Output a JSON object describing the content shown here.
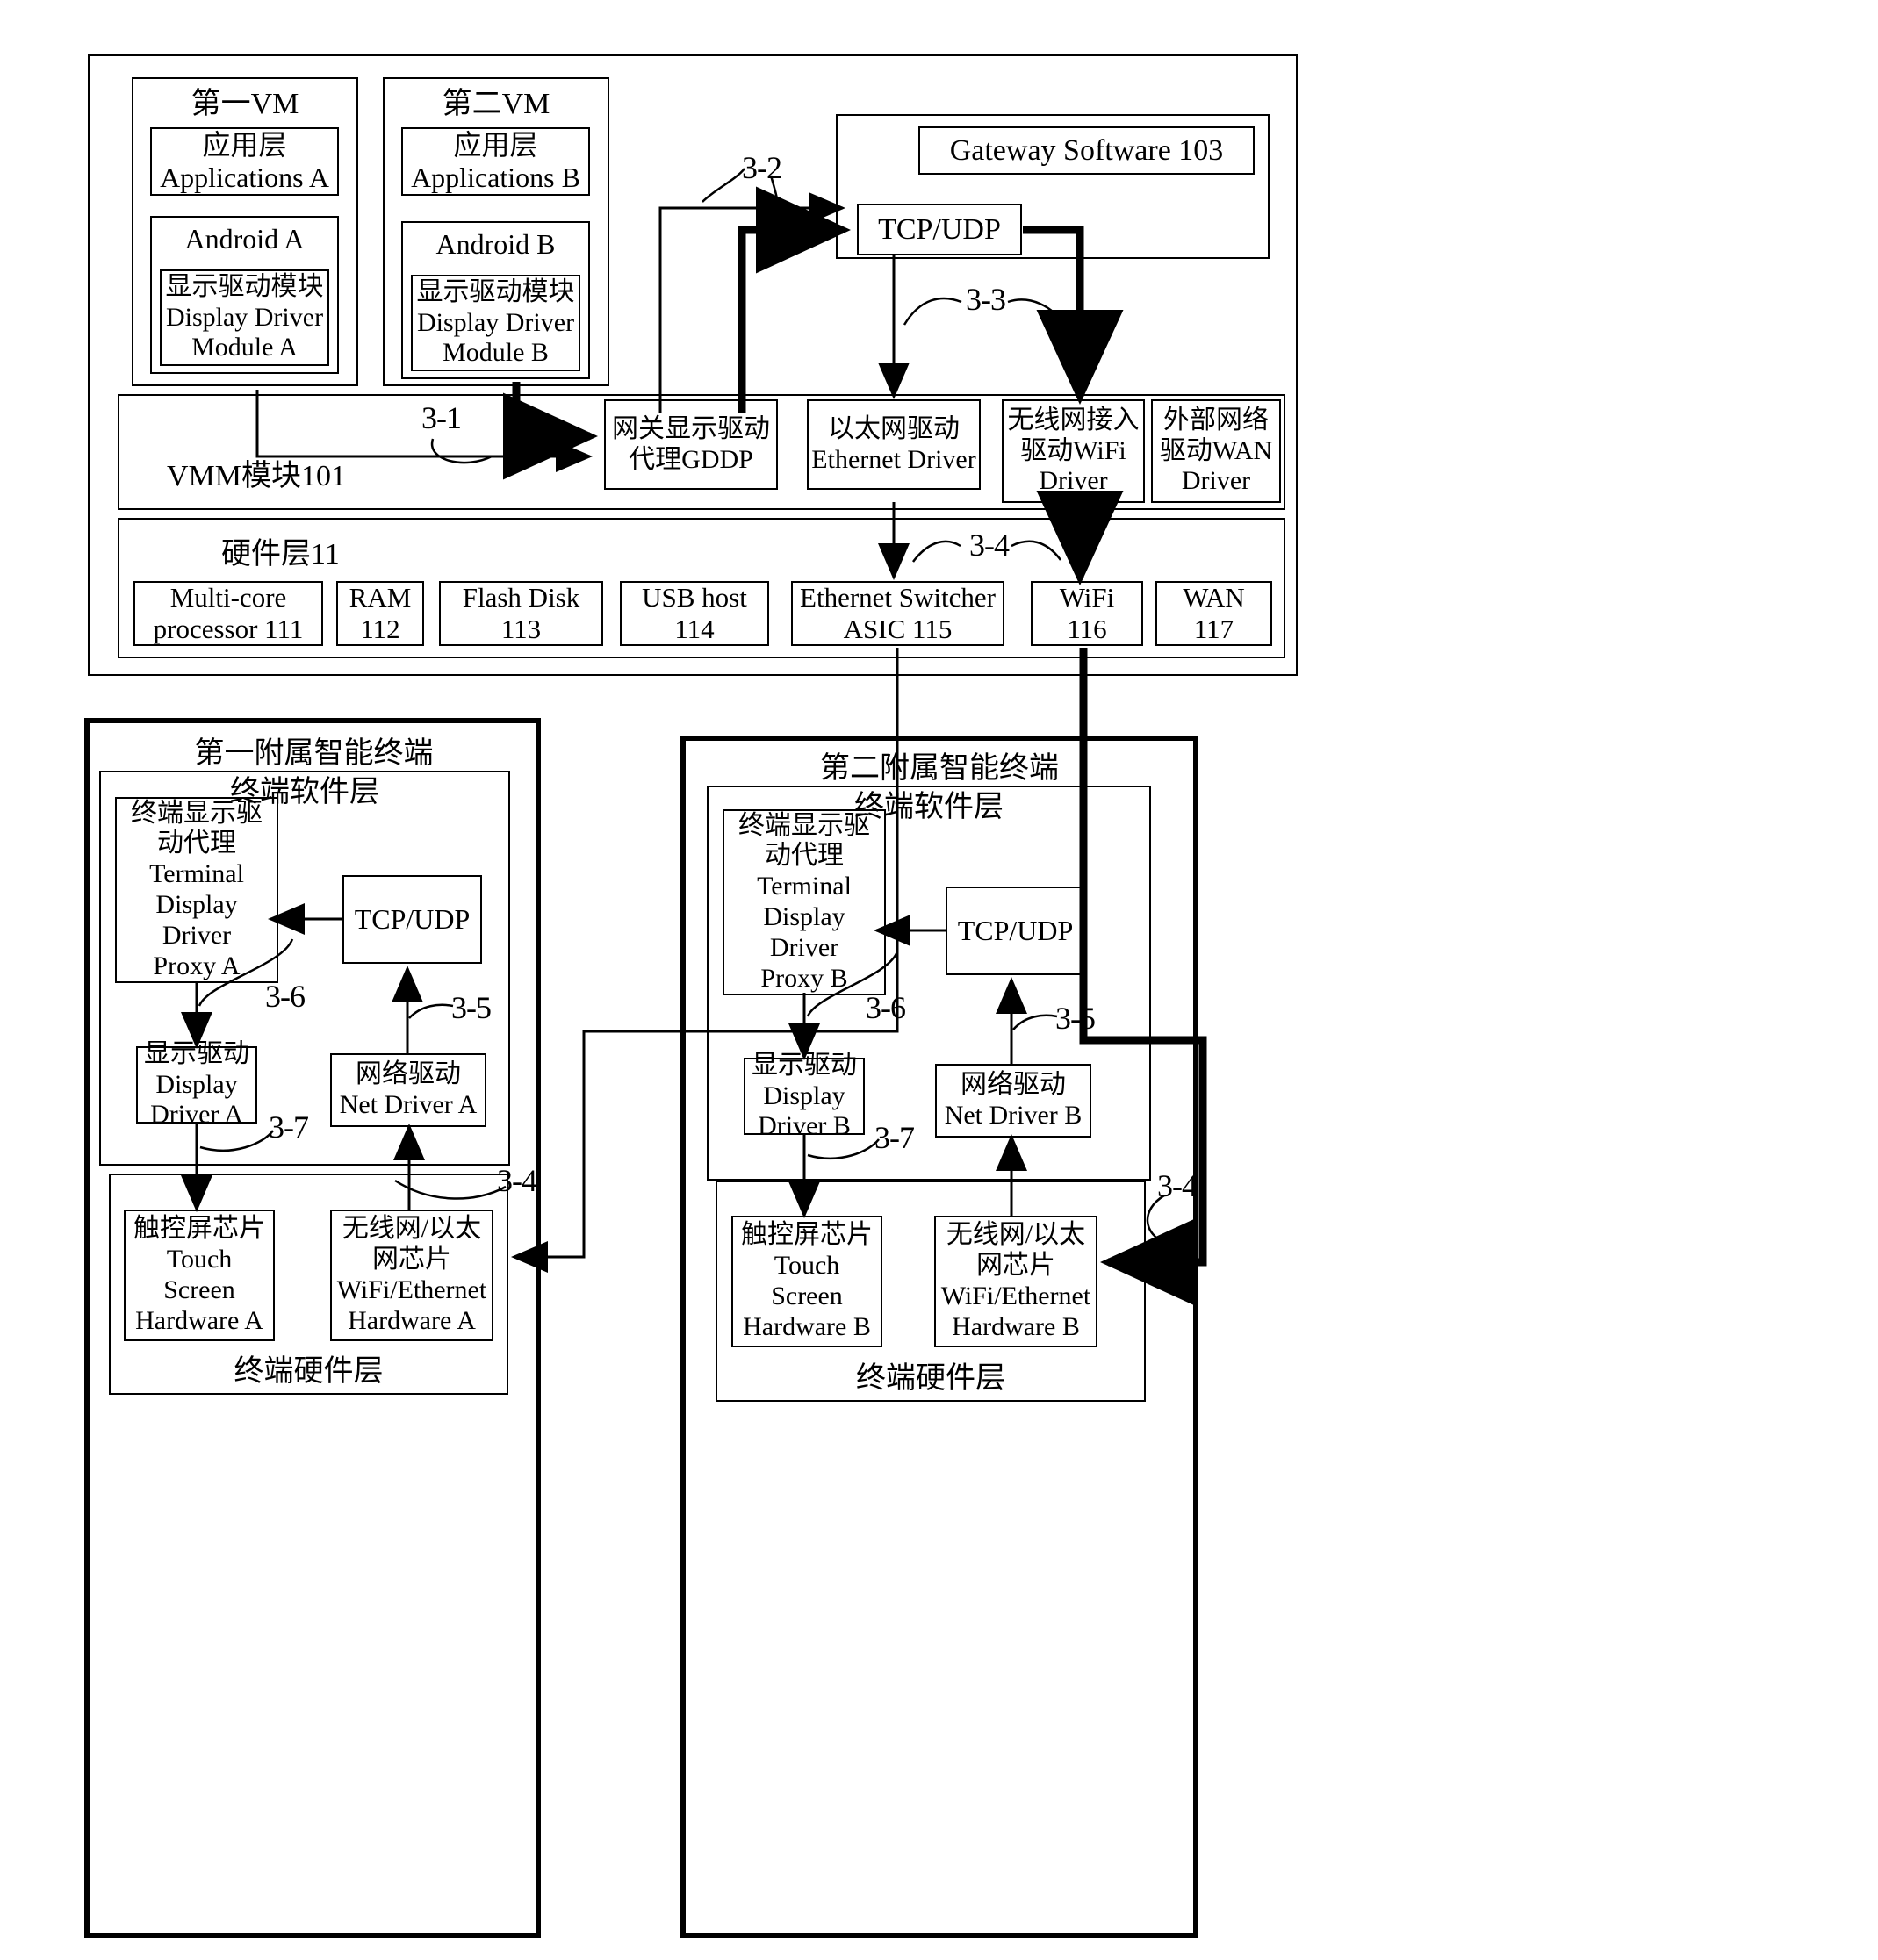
{
  "diagram": {
    "gateway_device": {
      "vm1": {
        "title": "第一VM",
        "applications": "应用层\nApplications A",
        "android": "Android A",
        "display_driver_module": "显示驱动模块\nDisplay Driver\nModule A"
      },
      "vm2": {
        "title": "第二VM",
        "applications": "应用层\nApplications B",
        "android": "Android B",
        "display_driver_module": "显示驱动模块\nDisplay Driver\nModule  B"
      },
      "gateway_software": {
        "title": "Gateway Software 103",
        "tcp_udp": "TCP/UDP"
      },
      "vmm": {
        "title": "VMM模块101",
        "gddp": "网关显示驱动\n代理GDDP",
        "ethernet_driver": "以太网驱动\nEthernet Driver",
        "wifi_driver": "无线网接入\n驱动WiFi\nDriver",
        "wan_driver": "外部网络\n驱动WAN\nDriver"
      },
      "hardware_layer": {
        "title": "硬件层11",
        "items": [
          "Multi-core\nprocessor 111",
          "RAM\n112",
          "Flash Disk\n113",
          "USB  host\n114",
          "Ethernet Switcher\nASIC 115",
          "WiFi\n116",
          "WAN\n117"
        ]
      }
    },
    "terminal_a": {
      "title": "第一附属智能终端",
      "software_layer": "终端软件层",
      "display_driver_proxy": "终端显示驱\n动代理\nTerminal\nDisplay\nDriver\nProxy A",
      "tcp_udp": "TCP/UDP",
      "display_driver": "显示驱动\nDisplay\nDriver A",
      "net_driver": "网络驱动\nNet Driver A",
      "hardware_layer": "终端硬件层",
      "touch_screen": "触控屏芯片\nTouch\nScreen\nHardware A",
      "wifi_ethernet": "无线网/以太\n网芯片\nWiFi/Ethernet\nHardware A"
    },
    "terminal_b": {
      "title": "第二附属智能终端",
      "software_layer": "终端软件层",
      "display_driver_proxy": "终端显示驱\n动代理\nTerminal\nDisplay\nDriver\nProxy B",
      "tcp_udp": "TCP/UDP",
      "display_driver": "显示驱动\nDisplay\nDriver B",
      "net_driver": "网络驱动\nNet Driver B",
      "hardware_layer": "终端硬件层",
      "touch_screen": "触控屏芯片\nTouch\nScreen\nHardware B",
      "wifi_ethernet": "无线网/以太\n网芯片\nWiFi/Ethernet\nHardware B"
    },
    "flow_labels": {
      "r31": "3-1",
      "r32": "3-2",
      "r33": "3-3",
      "r34_gateway": "3-4",
      "r34_terminal_a": "3-4",
      "r34_terminal_b": "3-4",
      "r35_a": "3-5",
      "r35_b": "3-5",
      "r36_a": "3-6",
      "r36_b": "3-6",
      "r37_a": "3-7",
      "r37_b": "3-7"
    }
  }
}
